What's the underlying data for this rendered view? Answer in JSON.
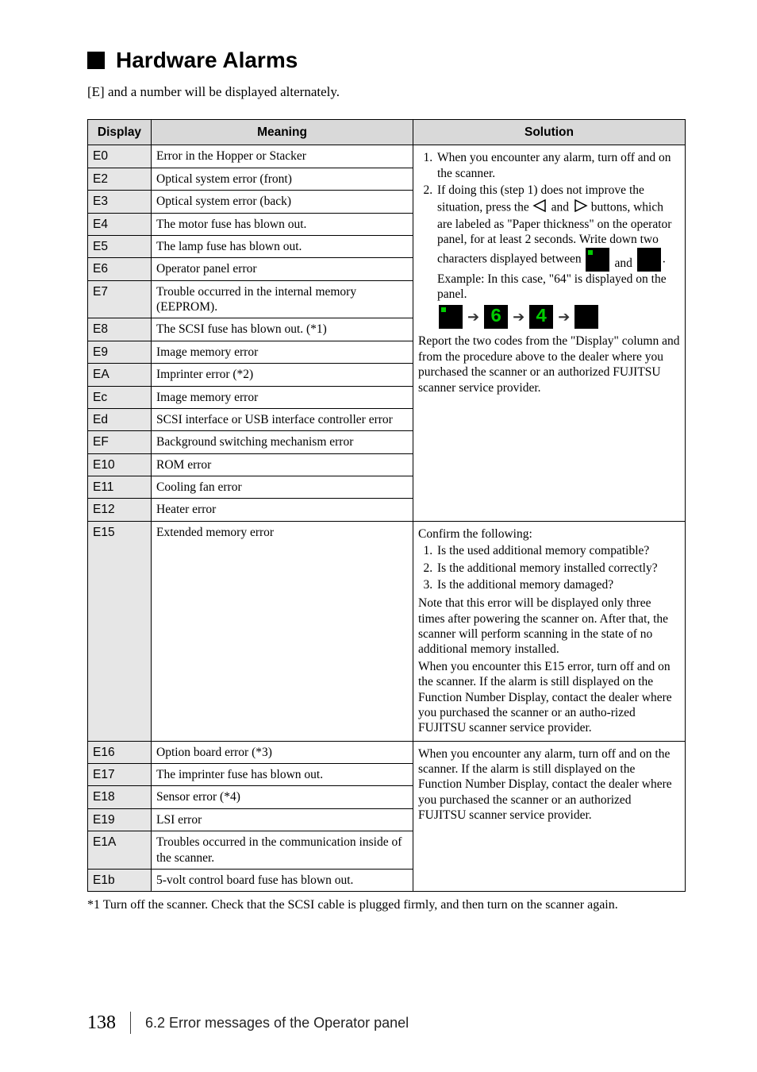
{
  "heading": "Hardware Alarms",
  "intro": "[E] and a number will be displayed alternately.",
  "headers": {
    "display": "Display",
    "meaning": "Meaning",
    "solution": "Solution"
  },
  "rows_group1": [
    {
      "code": "E0",
      "meaning": "Error in the Hopper or Stacker"
    },
    {
      "code": "E2",
      "meaning": "Optical system error (front)"
    },
    {
      "code": "E3",
      "meaning": "Optical system error (back)"
    },
    {
      "code": "E4",
      "meaning": "The motor fuse has blown out."
    },
    {
      "code": "E5",
      "meaning": "The lamp fuse has blown out."
    },
    {
      "code": "E6",
      "meaning": "Operator panel error"
    },
    {
      "code": "E7",
      "meaning": "Trouble occurred in the internal memory (EEPROM)."
    },
    {
      "code": "E8",
      "meaning": "The SCSI fuse has blown out. (*1)"
    },
    {
      "code": "E9",
      "meaning": "Image memory error"
    },
    {
      "code": "EA",
      "meaning": "Imprinter error (*2)"
    },
    {
      "code": "Ec",
      "meaning": "Image memory error"
    },
    {
      "code": "Ed",
      "meaning": "SCSI interface or USB interface controller error"
    },
    {
      "code": "EF",
      "meaning": "Background switching mechanism error"
    },
    {
      "code": "E10",
      "meaning": "ROM error"
    },
    {
      "code": "E11",
      "meaning": "Cooling fan error"
    },
    {
      "code": "E12",
      "meaning": "Heater error"
    }
  ],
  "row_e15": {
    "code": "E15",
    "meaning": "Extended memory error"
  },
  "rows_group3": [
    {
      "code": "E16",
      "meaning": "Option board error (*3)"
    },
    {
      "code": "E17",
      "meaning": "The imprinter fuse has blown out."
    },
    {
      "code": "E18",
      "meaning": "Sensor error (*4)"
    },
    {
      "code": "E19",
      "meaning": "LSI error"
    },
    {
      "code": "E1A",
      "meaning": "Troubles occurred in the communication inside of the scanner."
    },
    {
      "code": "E1b",
      "meaning": "5-volt control board fuse has blown out."
    }
  ],
  "solution1": {
    "li1": "When you encounter any alarm, turn off and on the scanner.",
    "li2a": "If doing this (step 1) does not improve the situation, press the ",
    "li2b": " and ",
    "li2c": " buttons, which are labeled as \"Paper thickness\" on the operator panel, for at least 2 seconds. Write down two characters displayed between ",
    "li2d": " and ",
    "li2e": ".",
    "example": "Example: In this case, \"64\" is displayed on the panel.",
    "report": "Report the two codes from the \"Display\" column and from the procedure above to the dealer where you purchased the scanner or an authorized FUJITSU scanner service provider."
  },
  "solution_e15": {
    "intro": "Confirm the following:",
    "li1": "Is the used additional memory compatible?",
    "li2": "Is the additional memory installed correctly?",
    "li3": "Is the additional memory damaged?",
    "note": "Note that this error will be displayed only three times after powering the scanner on. After that, the scanner will perform scanning in the state of no additional memory installed.",
    "note2": "When you encounter this E15 error, turn off and on the scanner. If the alarm is still displayed on the Function Number Display, contact the dealer where you purchased the scanner or an autho-rized FUJITSU scanner service provider."
  },
  "solution3": "When you encounter any alarm, turn off and on the scanner. If the alarm is still displayed on the Function Number Display, contact the dealer where you purchased the scanner or an authorized FUJITSU scanner service provider.",
  "footnote": "*1 Turn off the scanner. Check that the SCSI cable is plugged firmly, and then turn on the scanner again.",
  "footer": {
    "page": "138",
    "section": "6.2 Error messages of the Operator panel"
  },
  "digits": {
    "six": "6",
    "four": "4"
  }
}
